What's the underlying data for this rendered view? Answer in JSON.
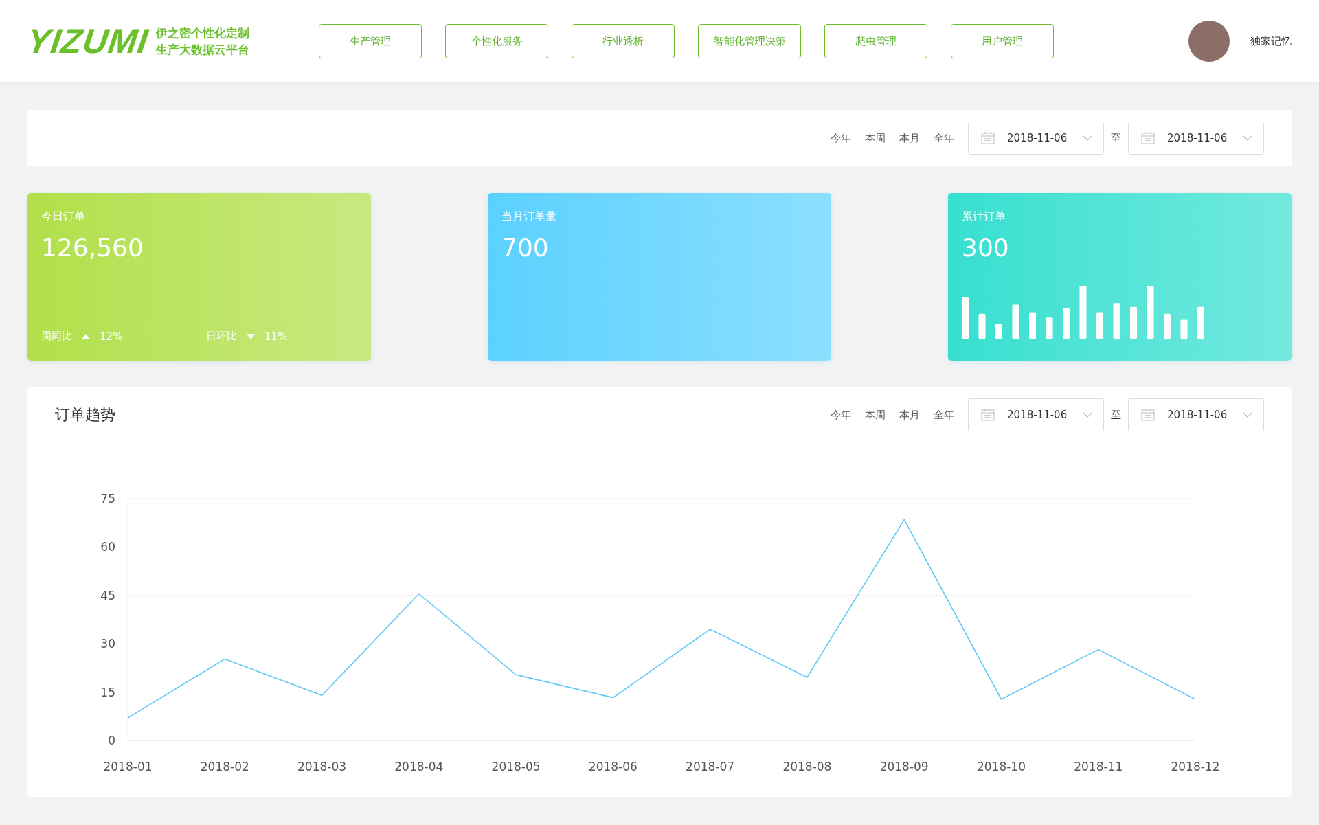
{
  "header": {
    "logo": "YIZUMI",
    "subtitle": [
      "伊之密个性化定制",
      "生产大数据云平台"
    ],
    "nav": [
      "生产管理",
      "个性化服务",
      "行业透析",
      "智能化管理决策",
      "爬虫管理",
      "用户管理"
    ],
    "user": {
      "name": "独家记忆"
    }
  },
  "filter_bar": {
    "ranges": [
      "今年",
      "本周",
      "本月",
      "全年"
    ],
    "start_date": "2018-11-06",
    "separator": "至",
    "end_date": "2018-11-06"
  },
  "cards": [
    {
      "kind": "compare",
      "title": "今日订单",
      "value": "126,560",
      "color": "#b1e04a",
      "compares": [
        {
          "label": "周同比",
          "rising": true,
          "value": "12%"
        },
        {
          "label": "日环比",
          "rising": false,
          "value": "11%"
        }
      ]
    },
    {
      "kind": "plain",
      "title": "当月订单量",
      "value": "700",
      "color": "#5ad1ff"
    },
    {
      "kind": "bars",
      "title": "累计订单",
      "value": "300",
      "color": "#37dfd0"
    }
  ],
  "trend": {
    "title": "订单趋势",
    "ranges": [
      "今年",
      "本周",
      "本月",
      "全年"
    ],
    "start_date": "2018-11-06",
    "separator": "至",
    "end_date": "2018-11-06",
    "chart_data": {
      "type": "line",
      "categories": [
        "2018-01",
        "2018-02",
        "2018-03",
        "2018-04",
        "2018-05",
        "2018-06",
        "2018-07",
        "2018-08",
        "2018-09",
        "2018-10",
        "2018-11",
        "2018-12"
      ],
      "series": [
        {
          "color": "#5cc8f6",
          "values": [
            7,
            25.3,
            14,
            45.5,
            20.4,
            13.3,
            34.5,
            19.6,
            68.5,
            12.8,
            28.2,
            12.8
          ]
        }
      ],
      "ylim": [
        0,
        75
      ],
      "yticks": [
        0,
        15,
        30,
        45,
        60,
        75
      ],
      "grid": true
    }
  }
}
